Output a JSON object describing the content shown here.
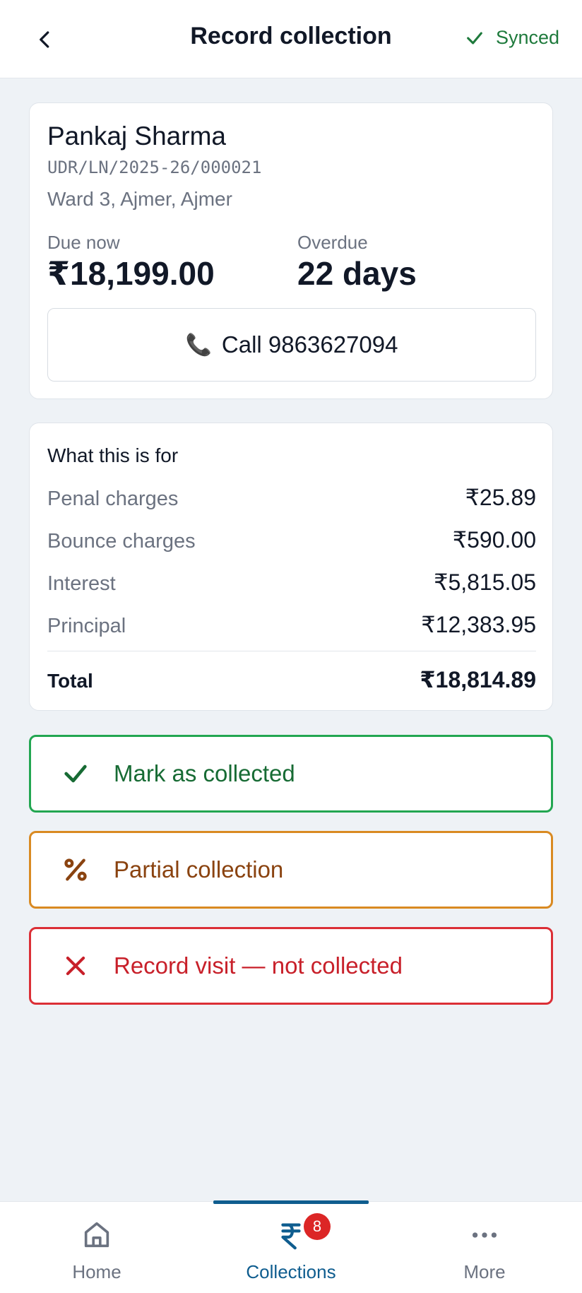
{
  "header": {
    "title": "Record collection",
    "sync_status": "Synced"
  },
  "borrower": {
    "name": "Pankaj Sharma",
    "loan_id": "UDR/LN/2025-26/000021",
    "address": "Ward 3, Ajmer, Ajmer",
    "due_label": "Due now",
    "due_value": "₹18,199.00",
    "overdue_label": "Overdue",
    "overdue_value": "22 days",
    "call_label": "Call 9863627094"
  },
  "breakdown": {
    "title": "What this is for",
    "rows": [
      {
        "label": "Penal charges",
        "value": "₹25.89"
      },
      {
        "label": "Bounce charges",
        "value": "₹590.00"
      },
      {
        "label": "Interest",
        "value": "₹5,815.05"
      },
      {
        "label": "Principal",
        "value": "₹12,383.95"
      }
    ],
    "total_label": "Total",
    "total_value": "₹18,814.89"
  },
  "actions": {
    "collected": "Mark as collected",
    "partial": "Partial collection",
    "not_collected": "Record visit — not collected"
  },
  "nav": {
    "home": "Home",
    "collections": "Collections",
    "collections_badge": "8",
    "more": "More",
    "active": "collections"
  },
  "colors": {
    "success": "#22a651",
    "warning": "#d98a22",
    "danger": "#db2f36",
    "accent": "#0f5d8f"
  }
}
